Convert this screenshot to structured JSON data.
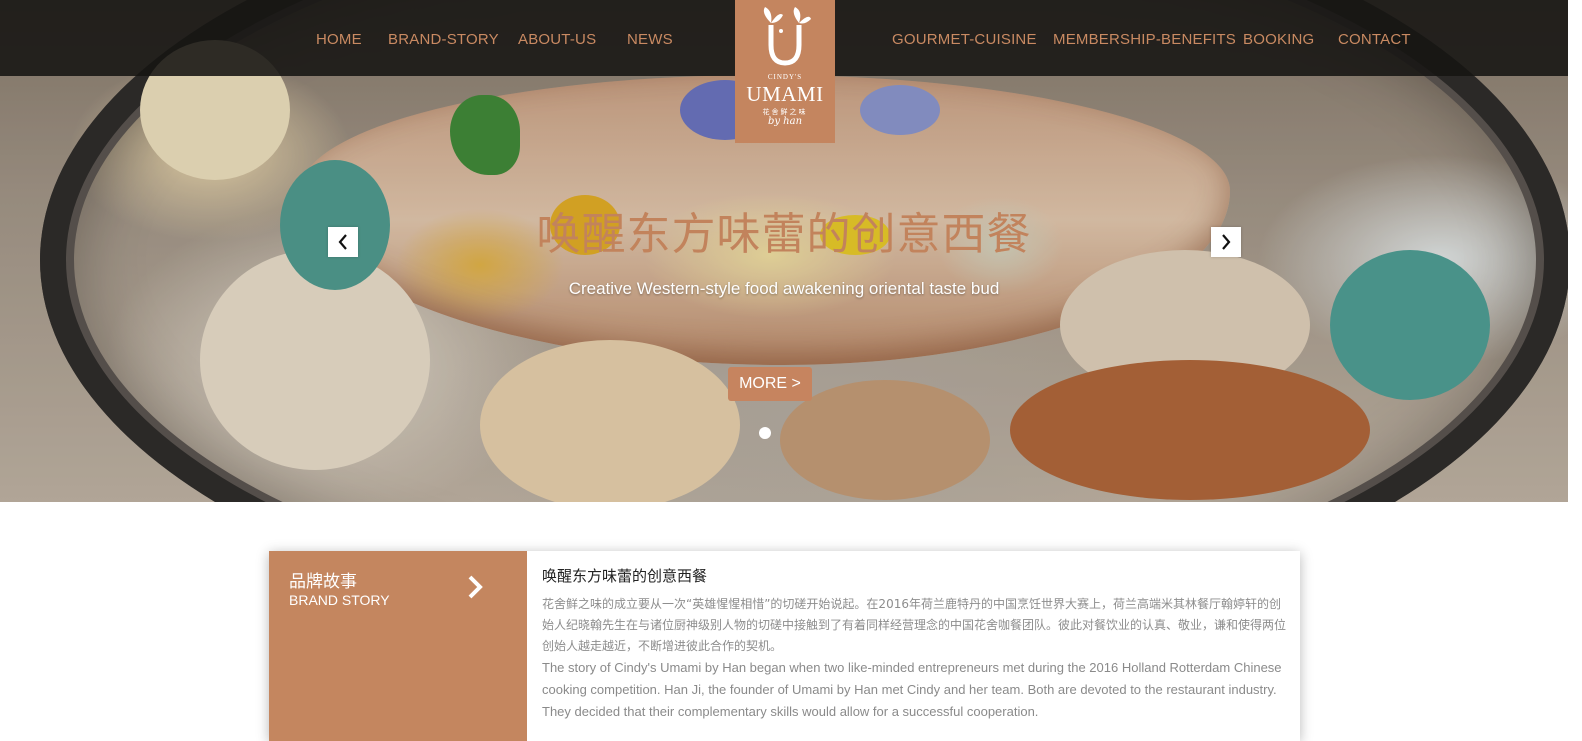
{
  "nav": {
    "left_items": [
      {
        "label": "HOME"
      },
      {
        "label": "BRAND-STORY"
      },
      {
        "label": "ABOUT-US"
      },
      {
        "label": "NEWS"
      }
    ],
    "right_items": [
      {
        "label": "GOURMET-CUISINE"
      },
      {
        "label": "MEMBERSHIP-BENEFITS"
      },
      {
        "label": "BOOKING"
      },
      {
        "label": "CONTACT"
      }
    ]
  },
  "logo": {
    "small_text": "CINDY'S",
    "name": "UMAMI",
    "chinese": "花舍鲜之味",
    "script": "by han"
  },
  "hero": {
    "title": "唤醒东方味蕾的创意西餐",
    "subtitle": "Creative Western-style food awakening oriental taste bud",
    "more_label": "MORE >",
    "prev_icon": "chevron-left-icon",
    "next_icon": "chevron-right-icon"
  },
  "brand_story": {
    "tab_cn": "品牌故事",
    "tab_en": "BRAND STORY",
    "heading": "唤醒东方味蕾的创意西餐",
    "text_cn": "花舍鲜之味的成立要从一次“英雄惺惺相惜”的切磋开始说起。在2016年荷兰鹿特丹的中国烹饪世界大赛上，荷兰高端米其林餐厅翰婷轩的创始人纪晓翰先生在与诸位厨神级别人物的切磋中接触到了有着同样经营理念的中国花舍咖餐团队。彼此对餐饮业的认真、敬业，谦和使得两位创始人越走越近，不断增进彼此合作的契机。",
    "text_en": "The story of Cindy's Umami by Han began when two like-minded entrepreneurs met during the 2016 Holland Rotterdam Chinese cooking competition. Han Ji, the founder of Umami by Han met Cindy and her team. Both are devoted to the restaurant industry. They decided that their complementary skills would allow for a successful cooperation."
  },
  "colors": {
    "accent": "#c4855f",
    "nav_bg": "#161412",
    "nav_text": "#c98a62"
  }
}
